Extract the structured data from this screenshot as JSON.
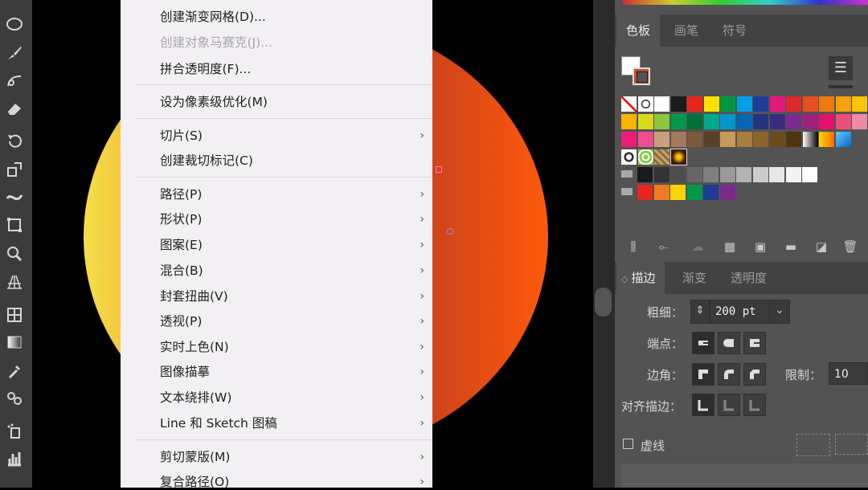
{
  "menu": {
    "items": [
      {
        "label": "创建渐变网格(D)...",
        "disabled": false,
        "submenu": false
      },
      {
        "label": "创建对象马赛克(J)...",
        "disabled": true,
        "submenu": false
      },
      {
        "label": "拼合透明度(F)...",
        "disabled": false,
        "submenu": false
      },
      {
        "label": "设为像素级优化(M)",
        "disabled": false,
        "submenu": false
      },
      {
        "label": "切片(S)",
        "disabled": false,
        "submenu": true
      },
      {
        "label": "创建裁切标记(C)",
        "disabled": false,
        "submenu": false
      },
      {
        "label": "路径(P)",
        "disabled": false,
        "submenu": true
      },
      {
        "label": "形状(P)",
        "disabled": false,
        "submenu": true
      },
      {
        "label": "图案(E)",
        "disabled": false,
        "submenu": true
      },
      {
        "label": "混合(B)",
        "disabled": false,
        "submenu": true
      },
      {
        "label": "封套扭曲(V)",
        "disabled": false,
        "submenu": true
      },
      {
        "label": "透视(P)",
        "disabled": false,
        "submenu": true
      },
      {
        "label": "实时上色(N)",
        "disabled": false,
        "submenu": true
      },
      {
        "label": "图像描摹",
        "disabled": false,
        "submenu": true
      },
      {
        "label": "文本绕排(W)",
        "disabled": false,
        "submenu": true
      },
      {
        "label": "Line 和 Sketch 图稿",
        "disabled": false,
        "submenu": true
      },
      {
        "label": "剪切蒙版(M)",
        "disabled": false,
        "submenu": true
      },
      {
        "label": "复合路径(O)",
        "disabled": false,
        "submenu": true
      }
    ],
    "arrow": "›"
  },
  "swatches_panel": {
    "tabs": [
      "色板",
      "画笔",
      "符号"
    ],
    "active_tab": "色板",
    "rows": [
      [
        "none",
        "registration",
        "#ffffff",
        "#1a1a1a",
        "#e8261e",
        "#ffe100",
        "#009a44",
        "#00a0e6",
        "#1e3c96",
        "#e5197d",
        "#e02b2b",
        "#e8501e",
        "#ef7a12",
        "#f6a20f",
        "#f7c600"
      ],
      [
        "#f8b400",
        "#d8d81e",
        "#8cc63e",
        "#00994c",
        "#006f3c",
        "#00a88e",
        "#0098c8",
        "#0068b4",
        "#23357e",
        "#3b2a84",
        "#7a2a8c",
        "#a0207c",
        "#e4106c",
        "#ea4f7a",
        "#f08ba6"
      ],
      [
        "#ec1c7a",
        "#f04d8c",
        "#c8a07c",
        "#a47b5a",
        "#7c5a3c",
        "#5a3f28",
        "#c89b58",
        "#a87e3c",
        "#8c6428",
        "#6e4b1e",
        "#503410",
        "gradient-bw",
        "gradient-orange",
        "gradient-blue"
      ],
      [
        "pattern-1",
        "pattern-2",
        "pattern-3",
        "pattern-4"
      ],
      [
        "#1a1a1a",
        "#333333",
        "#4d4d4d",
        "#666666",
        "#808080",
        "#999999",
        "#b3b3b3",
        "#cccccc",
        "#e6e6e6",
        "#f2f2f2",
        "#ffffff"
      ],
      [
        "#e8261e",
        "#f07a1e",
        "#ffd400",
        "#00994c",
        "#1e3c96",
        "#7a2a8c"
      ]
    ]
  },
  "stroke_panel": {
    "tabs": [
      "描边",
      "渐变",
      "透明度"
    ],
    "active_tab": "描边",
    "weight_label": "粗细：",
    "weight_value": "200 pt",
    "cap_label": "端点：",
    "corner_label": "边角：",
    "limit_label": "限制：",
    "limit_value": "10",
    "align_label": "对齐描边：",
    "dashed_label": "虚线"
  }
}
